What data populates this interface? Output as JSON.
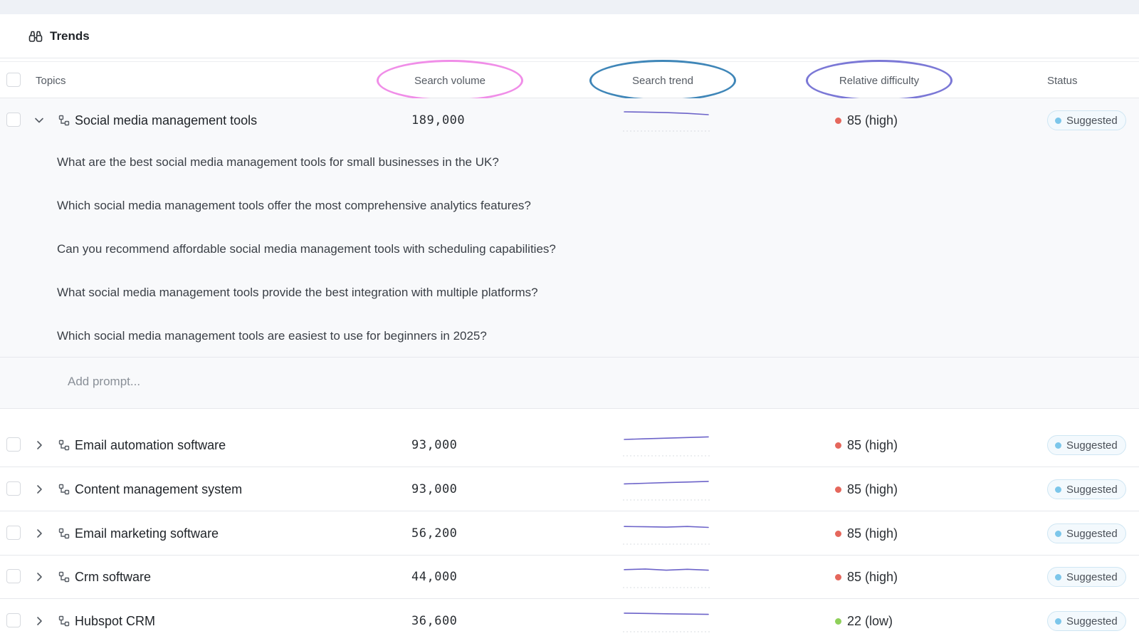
{
  "header": {
    "title": "Trends",
    "icon": "binoculars-icon"
  },
  "columns": {
    "topics": "Topics",
    "search_volume": "Search volume",
    "search_trend": "Search trend",
    "relative_difficulty": "Relative difficulty",
    "status": "Status"
  },
  "highlight_colors": {
    "search_volume": "#f08ee8",
    "search_trend": "#3f86b8",
    "relative_difficulty": "#7b78d6"
  },
  "expanded_topic": {
    "name": "Social media management tools",
    "volume": "189,000",
    "difficulty": "85 (high)",
    "difficulty_color": "#e5675c",
    "status": "Suggested",
    "trend": [
      0.5,
      0.48,
      0.45,
      0.4,
      0.32
    ],
    "prompts": [
      "What are the best social media management tools for small businesses in the UK?",
      "Which social media management tools offer the most comprehensive analytics features?",
      "Can you recommend affordable social media management tools with scheduling capabilities?",
      "What social media management tools provide the best integration with multiple platforms?",
      "Which social media management tools are easiest to use for beginners in 2025?"
    ],
    "add_prompt_placeholder": "Add prompt..."
  },
  "rows": [
    {
      "name": "Email automation software",
      "volume": "93,000",
      "difficulty": "85 (high)",
      "difficulty_color": "#e5675c",
      "status": "Suggested",
      "trend": [
        0.32,
        0.36,
        0.4,
        0.44,
        0.48
      ]
    },
    {
      "name": "Content management system",
      "volume": "93,000",
      "difficulty": "85 (high)",
      "difficulty_color": "#e5675c",
      "status": "Suggested",
      "trend": [
        0.3,
        0.34,
        0.38,
        0.42,
        0.46
      ]
    },
    {
      "name": "Email marketing software",
      "volume": "56,200",
      "difficulty": "85 (high)",
      "difficulty_color": "#e5675c",
      "status": "Suggested",
      "trend": [
        0.4,
        0.38,
        0.36,
        0.4,
        0.34
      ]
    },
    {
      "name": "Crm software",
      "volume": "44,000",
      "difficulty": "85 (high)",
      "difficulty_color": "#e5675c",
      "status": "Suggested",
      "trend": [
        0.42,
        0.46,
        0.38,
        0.44,
        0.38
      ]
    },
    {
      "name": "Hubspot CRM",
      "volume": "36,600",
      "difficulty": "22 (low)",
      "difficulty_color": "#8fd05a",
      "status": "Suggested",
      "trend": [
        0.46,
        0.44,
        0.42,
        0.4,
        0.38
      ]
    }
  ]
}
